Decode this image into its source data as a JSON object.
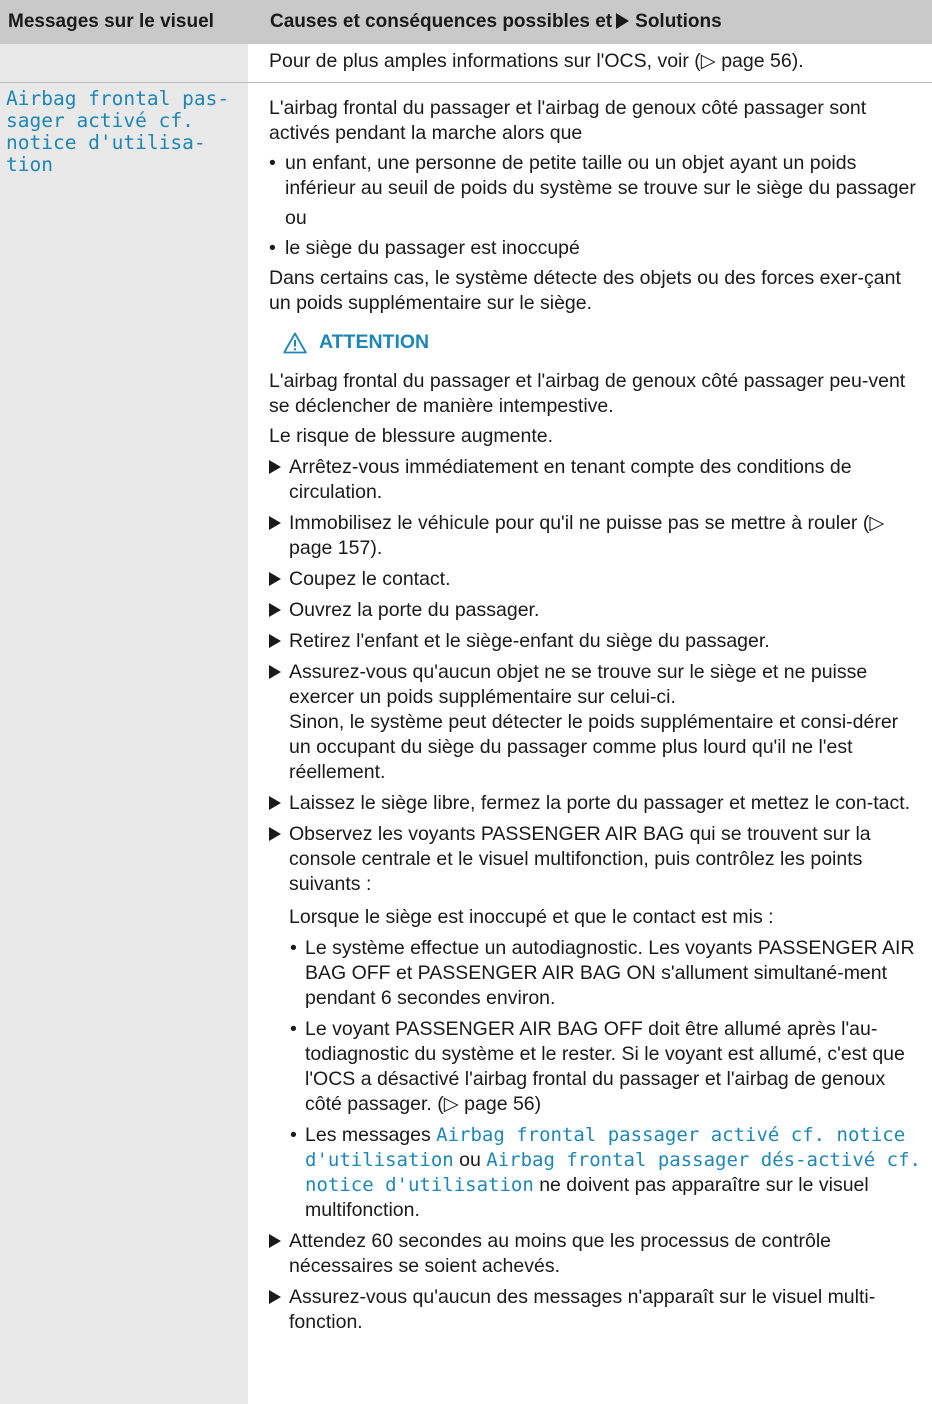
{
  "header": {
    "left": "Messages sur le visuel",
    "right_prefix": "Causes et conséquences possibles et",
    "right_suffix": "Solutions"
  },
  "ocs_line": "Pour de plus amples informations sur l'OCS, voir (▷ page 56).",
  "message_title": "Airbag frontal pas-\nsager activé cf.\nnotice d'utilisa-\ntion",
  "intro": "L'airbag frontal du passager et l'airbag de genoux côté passager sont activés pendant la marche alors que",
  "bullet1": "un enfant, une personne de petite taille ou un objet ayant un poids inférieur au seuil de poids du système se trouve sur le siège du passager",
  "ou": "ou",
  "bullet2": "le siège du passager est inoccupé",
  "detect": "Dans certains cas, le système détecte des objets ou des forces exer-çant un poids supplémentaire sur le siège.",
  "warning_label": "ATTENTION",
  "warn_text1": "L'airbag frontal du passager et l'airbag de genoux côté passager peu-vent se déclencher de manière intempestive.",
  "warn_text2": "Le risque de blessure augmente.",
  "steps": {
    "s1": "Arrêtez-vous immédiatement en tenant compte des conditions de circulation.",
    "s2": "Immobilisez le véhicule pour qu'il ne puisse pas se mettre à rouler (▷ page 157).",
    "s3": "Coupez le contact.",
    "s4": "Ouvrez la porte du passager.",
    "s5": "Retirez l'enfant et le siège-enfant du siège du passager.",
    "s6": "Assurez-vous qu'aucun objet ne se trouve sur le siège et ne puisse exercer un poids supplémentaire sur celui-ci.",
    "s6b": "Sinon, le système peut détecter le poids supplémentaire et consi-dérer un occupant du siège du passager comme plus lourd qu'il ne l'est réellement.",
    "s7": "Laissez le siège libre, fermez la porte du passager et mettez le con-tact.",
    "s8": "Observez les voyants PASSENGER AIR BAG qui se trouvent sur la console centrale et le visuel multifonction, puis contrôlez les points suivants :",
    "s9": "Attendez 60 secondes au moins que les processus de contrôle nécessaires se soient achevés.",
    "s10": "Assurez-vous qu'aucun des messages n'apparaît sur le visuel multi-fonction."
  },
  "check_intro": "Lorsque le siège est inoccupé et que le contact est mis :",
  "checks": {
    "c1": "Le système effectue un autodiagnostic. Les voyants PASSENGER AIR BAG OFF et PASSENGER AIR BAG ON s'allument simultané-ment pendant 6 secondes environ.",
    "c2": "Le voyant PASSENGER AIR BAG OFF doit être allumé après l'au-todiagnostic du système et le rester. Si le voyant est allumé, c'est que l'OCS a désactivé l'airbag frontal du passager et l'airbag de genoux côté passager. (▷ page 56)",
    "c3_pre": "Les messages",
    "c3_msg1": "Airbag frontal passager activé cf. notice d'utilisation",
    "c3_or": "ou",
    "c3_msg2": "Airbag frontal passager dés-activé cf. notice d'utilisation",
    "c3_post": "ne doivent pas apparaître sur le visuel multifonction."
  }
}
